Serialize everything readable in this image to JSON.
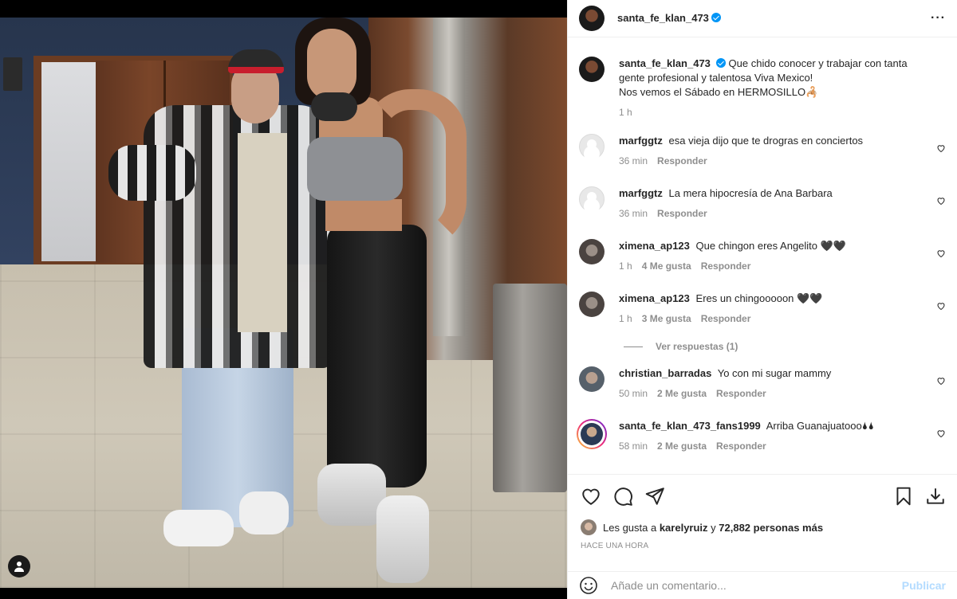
{
  "post": {
    "author": "santa_fe_klan_473",
    "verified": true,
    "caption": {
      "username": "santa_fe_klan_473",
      "lines": [
        "Que chido conocer y trabajar con tanta",
        "gente profesional y talentosa Viva Mexico!",
        "Nos vemos el Sábado en HERMOSILLO🦂"
      ],
      "time": "1 h"
    },
    "comments": [
      {
        "username": "marfggtz",
        "text": "esa vieja dijo que te drogras en conciertos",
        "time": "36 min",
        "likes": "",
        "reply": "Responder",
        "avatar": "default"
      },
      {
        "username": "marfggtz",
        "text": "La mera hipocresía de Ana Barbara",
        "time": "36 min",
        "likes": "",
        "reply": "Responder",
        "avatar": "default"
      },
      {
        "username": "ximena_ap123",
        "text": "Que chingon eres Angelito 🖤🖤",
        "time": "1 h",
        "likes": "4 Me gusta",
        "reply": "Responder",
        "avatar": "photo"
      },
      {
        "username": "ximena_ap123",
        "text": "Eres un chingooooon 🖤🖤",
        "time": "1 h",
        "likes": "3 Me gusta",
        "reply": "Responder",
        "avatar": "photo"
      },
      {
        "username": "christian_barradas",
        "text": "Yo con mi sugar mammy",
        "time": "50 min",
        "likes": "2 Me gusta",
        "reply": "Responder",
        "avatar": "photo"
      },
      {
        "username": "santa_fe_klan_473_fans1999",
        "text": "Arriba Guanajuatooo🌢🌢",
        "time": "58 min",
        "likes": "2 Me gusta",
        "reply": "Responder",
        "avatar": "story"
      }
    ],
    "view_replies": "Ver respuestas (1)",
    "likes_prefix": "Les gusta a ",
    "likes_user": "karelyruiz",
    "likes_mid": " y ",
    "likes_count": "72,882 personas más",
    "posted_ago": "HACE UNA HORA",
    "add_comment_placeholder": "Añade un comentario...",
    "publish_label": "Publicar"
  },
  "icons": {
    "more": "more-options-icon",
    "like": "heart-icon",
    "comment": "comment-icon",
    "share": "share-icon",
    "save": "bookmark-icon",
    "download": "download-icon",
    "emoji": "emoji-icon",
    "tag": "user-tag-icon"
  },
  "colors": {
    "accent": "#0095f6",
    "muted": "#8e8e8e",
    "publish_disabled": "#b3dbff"
  }
}
